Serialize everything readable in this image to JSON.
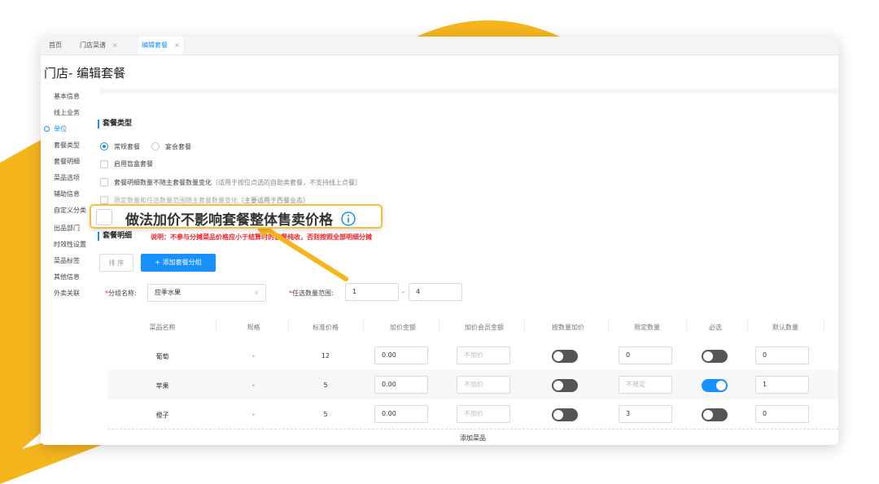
{
  "colors": {
    "accent": "#1890ff",
    "brand_yellow": "#f5b51d",
    "required": "#f5222d",
    "warning_text": "#f5222d"
  },
  "tabs": [
    {
      "label": "首页",
      "active": false,
      "closable": false
    },
    {
      "label": "门店菜谱",
      "active": false,
      "closable": true
    },
    {
      "label": "编辑套餐",
      "active": true,
      "closable": true
    }
  ],
  "tab_close": "×",
  "page_title": "门店- 编辑套餐",
  "sidenav": [
    {
      "label": "基本信息"
    },
    {
      "label": "线上业务"
    },
    {
      "label": "单位",
      "active": true
    },
    {
      "label": "套餐类型"
    },
    {
      "label": "套餐明细"
    },
    {
      "label": "菜品选项"
    },
    {
      "label": "辅助信息"
    },
    {
      "label": "自定义分类"
    },
    {
      "label": "出品部门"
    },
    {
      "label": "时效性设置"
    },
    {
      "label": "菜品标签"
    },
    {
      "label": "其他信息"
    },
    {
      "label": "外卖关联"
    }
  ],
  "combo_type": {
    "title": "套餐类型",
    "options": [
      {
        "label": "常规套餐",
        "selected": true
      },
      {
        "label": "宴会套餐",
        "selected": false
      }
    ],
    "blind_box": "启用盲盒套餐",
    "qty_option": {
      "label": "套餐明细数量不随主套餐数量变化",
      "hint": "（适用于按位点选的自助类套餐，不支持线上点餐）"
    },
    "limit_option": {
      "label": "限定数量和任选数量范围随主套餐数量变化",
      "hint": "（主要适用于西餐业态）"
    }
  },
  "callout": {
    "text": "做法加价不影响套餐整体售卖价格",
    "icon": "info-circle-icon"
  },
  "detail": {
    "title": "套餐明细",
    "note": "说明：不参与分摊菜品价格应小于结算时的套餐纯收，否则按照全部明细分摊",
    "sort_button": "排 序",
    "add_group_button": "+ 添加套餐分组",
    "group_name_label": "分组名称:",
    "group_name_value": "应季水果",
    "range_label": "任选数量范围:",
    "range_min": "1",
    "range_sep": "-",
    "range_max": "4",
    "add_dish": "添加菜品"
  },
  "table": {
    "headers": [
      "菜品名称",
      "规格",
      "标准价格",
      "加价金额",
      "加价会员金额",
      "按数量加价",
      "限定数量",
      "必选",
      "默认数量"
    ],
    "rows": [
      {
        "name": "葡萄",
        "spec": "-",
        "price": "12",
        "markup": "0.00",
        "member_markup": "不加价",
        "qty_markup": false,
        "limit": "0",
        "limit_placeholder": false,
        "required": false,
        "default_qty": "0"
      },
      {
        "name": "苹果",
        "spec": "-",
        "price": "5",
        "markup": "0.00",
        "member_markup": "不加价",
        "qty_markup": false,
        "limit": "不限定",
        "limit_placeholder": true,
        "required": true,
        "default_qty": "1"
      },
      {
        "name": "橙子",
        "spec": "-",
        "price": "5",
        "markup": "0.00",
        "member_markup": "不加价",
        "qty_markup": false,
        "limit": "3",
        "limit_placeholder": false,
        "required": false,
        "default_qty": "0"
      }
    ]
  }
}
